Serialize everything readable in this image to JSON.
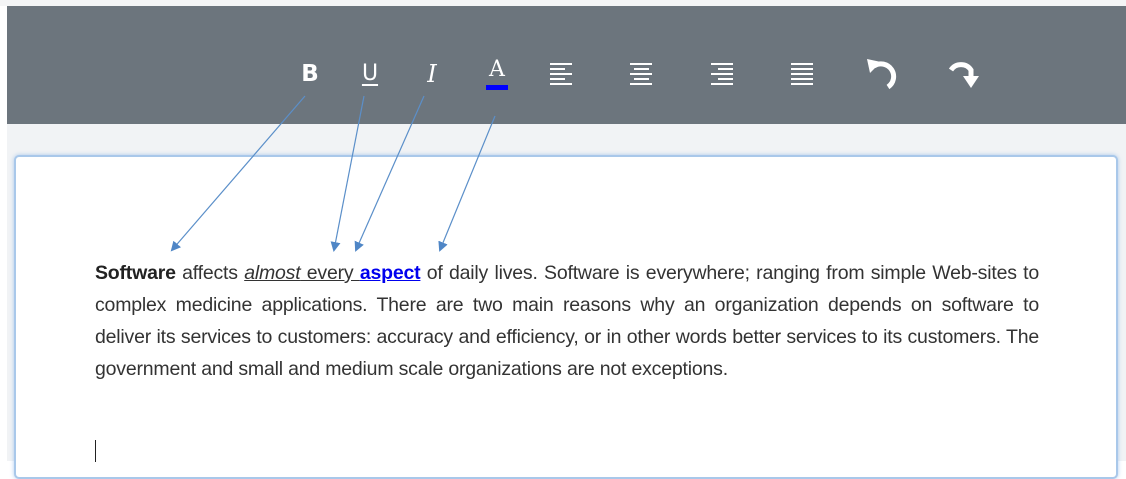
{
  "toolbar": {
    "bold": {
      "glyph": "B",
      "icon": "bold-icon"
    },
    "underline": {
      "glyph": "U",
      "icon": "underline-icon"
    },
    "italic": {
      "glyph": "I",
      "icon": "italic-icon"
    },
    "font_color": {
      "glyph": "A",
      "icon": "font-color-icon",
      "color": "#0000ff"
    },
    "align_left": {
      "icon": "align-left-icon"
    },
    "align_center": {
      "icon": "align-center-icon"
    },
    "align_right": {
      "icon": "align-right-icon"
    },
    "justify": {
      "icon": "justify-icon"
    },
    "undo": {
      "glyph": "↶",
      "icon": "undo-icon"
    },
    "redo": {
      "glyph": "↷",
      "icon": "redo-icon"
    }
  },
  "editor": {
    "word_bold": "Software",
    "text_1": " affects ",
    "word_italic_underline": "almost",
    "word_underline": " every ",
    "word_colored": "aspect",
    "text_2": " of daily lives. Software is everywhere; ranging from simple Web-sites to complex medicine applications. There are two main reasons why an organization depends on software to deliver its services to customers: accuracy and efficiency, or in other words better services to its customers. The government and small and medium scale organizations are not exceptions."
  },
  "colors": {
    "toolbar_bg": "#6c757d",
    "editor_border": "#a9c8ea",
    "link_color": "#0000ee",
    "arrow_color": "#5b8fc9"
  }
}
